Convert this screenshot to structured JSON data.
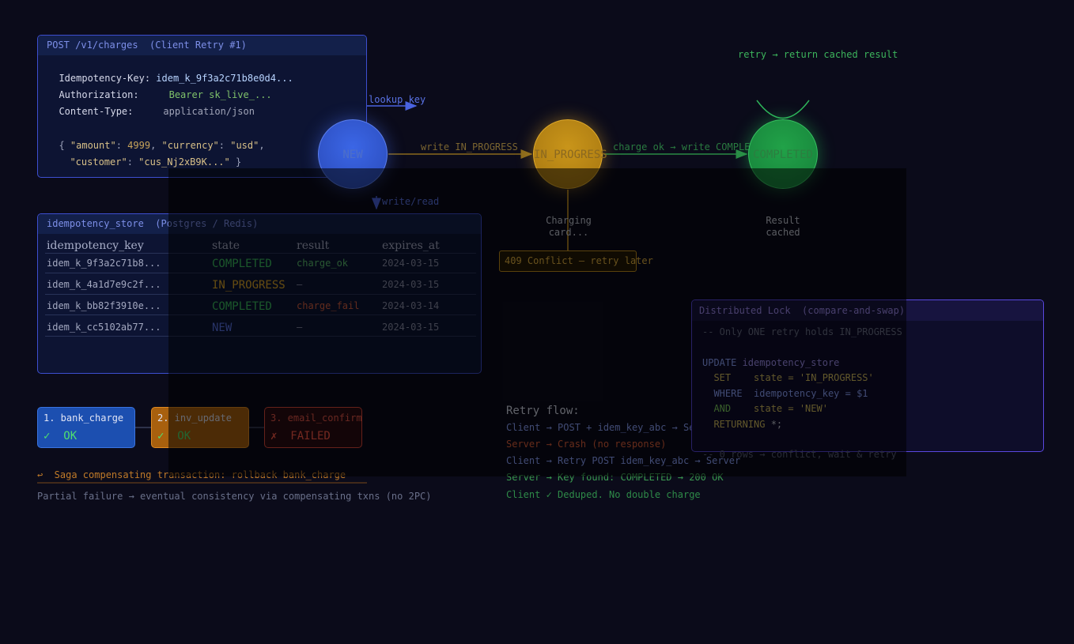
{
  "request": {
    "title": "POST /v1/charges  (Client Retry #1)",
    "idem_label": "Idempotency-Key:",
    "idem_value": "idem_k_9f3a2c71b8e0d4...",
    "auth_label": "Authorization:",
    "auth_value": "Bearer sk_live_...",
    "ctype_label": "Content-Type:",
    "ctype_value": "application/json",
    "body_line1": {
      "open": "{ ",
      "k1": "\"amount\"",
      "c1": ": ",
      "v1": "4999",
      "sep": ", ",
      "k2": "\"currency\"",
      "c2": ": ",
      "v2": "\"usd\"",
      "end": ","
    },
    "body_line2": {
      "k3": "\"customer\"",
      "c3": ": ",
      "v3": "\"cus_Nj2xB9K...\"",
      "close": " }"
    }
  },
  "arrows": {
    "lookup": "lookup key",
    "write_read": "write/read",
    "write_in_progress": "write IN_PROGRESS",
    "charge_ok": "charge ok → write COMPLETED",
    "retry_cached": "retry → return cached result"
  },
  "nodes": {
    "new": "NEW",
    "in_progress": "IN_PROGRESS",
    "completed": "COMPLETED",
    "charging_label": "Charging\ncard...",
    "result_label": "Result\ncached",
    "conflict": "409 Conflict — retry later"
  },
  "store": {
    "title": "idempotency_store  (Postgres / Redis)",
    "headers": [
      "idempotency_key",
      "state",
      "result",
      "expires_at"
    ],
    "rows": [
      {
        "key": "idem_k_9f3a2c71b8...",
        "state": "COMPLETED",
        "result": "charge_ok",
        "expires": "2024-03-15"
      },
      {
        "key": "idem_k_4a1d7e9c2f...",
        "state": "IN_PROGRESS",
        "result": "—",
        "expires": "2024-03-15"
      },
      {
        "key": "idem_k_bb82f3910e...",
        "state": "COMPLETED",
        "result": "charge_fail",
        "expires": "2024-03-14"
      },
      {
        "key": "idem_k_cc5102ab77...",
        "state": "NEW",
        "result": "—",
        "expires": "2024-03-15"
      }
    ]
  },
  "saga": {
    "steps": [
      {
        "title": "1. bank_charge",
        "status": "✓  OK"
      },
      {
        "title": "2. inv_update",
        "status": "✓  OK"
      },
      {
        "title": "3. email_confirm",
        "status": "✗  FAILED"
      }
    ],
    "compensate": "↩  Saga compensating transaction: rollback bank_charge",
    "note": "Partial failure → eventual consistency via compensating txns (no 2PC)"
  },
  "retry_flow": {
    "title": "Retry flow:",
    "lines": [
      {
        "actor": "Client",
        "text": " → POST + idem_key_abc → Server"
      },
      {
        "actor": "Server",
        "text": " → Crash (no response)"
      },
      {
        "actor": "Client",
        "text": " → Retry POST idem_key_abc → Server"
      },
      {
        "actor": "Server",
        "text": " → Key found: COMPLETED → 200 OK"
      },
      {
        "actor": "Client",
        "text": " ✓ Deduped. No double charge"
      }
    ]
  },
  "lock": {
    "title": "Distributed Lock  (compare-and-swap)",
    "comment": "-- Only ONE retry holds IN_PROGRESS",
    "sql": [
      {
        "kw": "UPDATE",
        "rest": " idempotency_store"
      },
      {
        "kw": "  SET",
        "rest": "    state = 'IN_PROGRESS'"
      },
      {
        "kw": "  WHERE",
        "rest": "  idempotency_key = $1"
      },
      {
        "kw": "  AND",
        "rest": "    state = 'NEW'"
      },
      {
        "kw": "  RETURNING",
        "rest": " *;"
      }
    ],
    "footer": "-- 0 rows → conflict, wait & retry"
  },
  "colors": {
    "blue": "#3d5be0",
    "amber": "#d9a020",
    "green": "#2fb45a",
    "red": "#d94a3a",
    "purple": "#6a4fe0"
  }
}
